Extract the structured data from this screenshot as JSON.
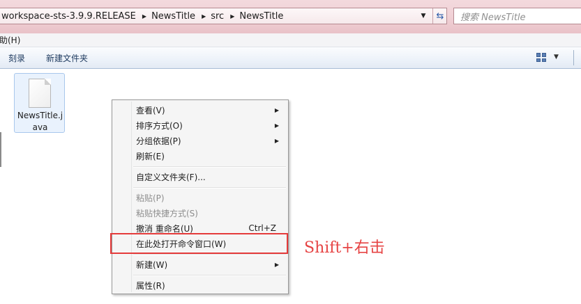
{
  "address_bar": {
    "crumbs": [
      "workspace-sts-3.9.9.RELEASE",
      "NewsTitle",
      "src",
      "NewsTitle"
    ]
  },
  "search": {
    "placeholder": "搜索 NewsTitle"
  },
  "menubar": {
    "item": "助(H)"
  },
  "toolbar": {
    "burn": "刻录",
    "new_folder": "新建文件夹"
  },
  "file": {
    "name": "NewsTitle.java"
  },
  "context_menu": {
    "view": "查看(V)",
    "sort": "排序方式(O)",
    "group": "分组依据(P)",
    "refresh": "刷新(E)",
    "customize": "自定义文件夹(F)...",
    "paste": "粘贴(P)",
    "paste_shortcut": "粘贴快捷方式(S)",
    "undo_rename": "撤消 重命名(U)",
    "undo_shortcut": "Ctrl+Z",
    "open_cmd": "在此处打开命令窗口(W)",
    "new": "新建(W)",
    "properties": "属性(R)"
  },
  "annotation": "Shift+右击",
  "colors": {
    "highlight": "#e53a3a",
    "annotation": "#e64444"
  }
}
